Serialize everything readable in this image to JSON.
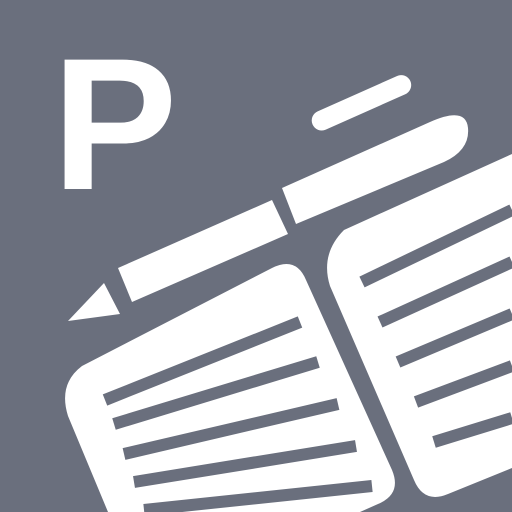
{
  "app_icon": {
    "letter": "P",
    "icon_name": "notebook-pen-icon",
    "background_color": "#6a6f7d",
    "foreground_color": "#ffffff"
  }
}
